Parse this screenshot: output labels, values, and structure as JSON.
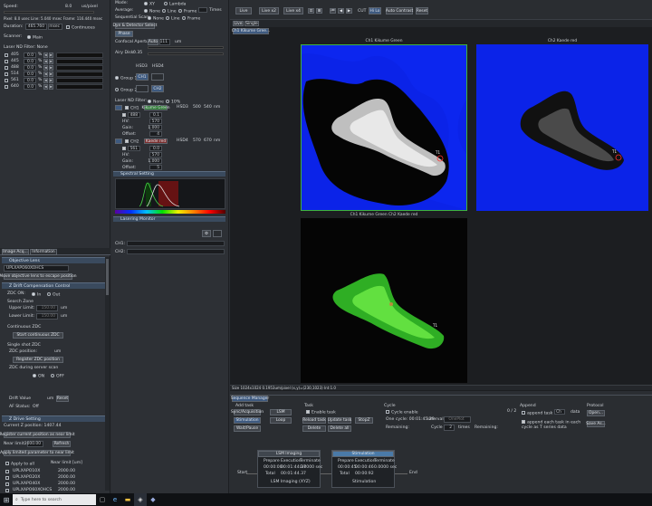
{
  "left": {
    "speed_label": "Speed:",
    "speed_value": "8.0",
    "speed_unit": "us/pixel",
    "pixel_line_frame": "Pixel: 8.0 usec  Line: 5.040 msec  Frame: 116.440 msec",
    "duration_label": "Duration:",
    "duration_value": "465.760",
    "duration_unit": "msec",
    "continuous_label": "Continuous",
    "scanner_label": "Scanner:",
    "scanner_value": "Main",
    "laser_header": "Laser ND Filter: None",
    "lasers": [
      {
        "wl": "405",
        "val": "0.0",
        "unit": "%"
      },
      {
        "wl": "445",
        "val": "0.0",
        "unit": "%"
      },
      {
        "wl": "488",
        "val": "0.0",
        "unit": "%"
      },
      {
        "wl": "514",
        "val": "0.0",
        "unit": "%"
      },
      {
        "wl": "561",
        "val": "0.0",
        "unit": "%"
      },
      {
        "wl": "640",
        "val": "0.0",
        "unit": "%"
      }
    ],
    "tabs": [
      "Image Acq...",
      "Information"
    ],
    "objective_header": "Objective Lens",
    "objective_value": "UPLXAPO60XOHCS",
    "move_objective_btn": "Move objective lens to escape position",
    "zdc_header": "Z Drift Compensation Control",
    "zdc_label": "ZDC ON:",
    "zdc_in": "In",
    "zdc_out": "Out",
    "search_zone": "Search Zone",
    "upper_label": "Upper Limit:",
    "upper_value": "150.00",
    "lower_label": "Lower Limit:",
    "lower_value": "150.00",
    "um": "um",
    "continuous_zdc": "Continuous ZDC",
    "start_zdc_btn": "Start continuous ZDC",
    "single_zdc": "Single shot ZDC",
    "zdc_position": "ZDC position:",
    "zdc_pos_unit": "um",
    "register_btn": "Register ZDC position",
    "zdc_sensor": "ZDC during server scan",
    "on": "ON",
    "off": "OFF",
    "drift_label": "Drift Value",
    "drift_unit": "um",
    "reset_btn": "Reset",
    "af_status": "AF Status:",
    "af_value": "Off",
    "z_header": "Z Drive Setting",
    "current_z": "Current Z position: 1407.44",
    "register_current_btn": "Register current position as near limit",
    "near_label": "Near limit:",
    "near_value": "2000.00",
    "refresh_btn": "Refresh",
    "apply_btn": "Apply limited parameter to near limit",
    "apply_all": "Apply to all",
    "near_limit_col": "Near limit [um]",
    "obj_rows": [
      {
        "name": "UPLXAPO10X",
        "val": "2000.00"
      },
      {
        "name": "UPLXAPO20X",
        "val": "2000.00"
      },
      {
        "name": "UPLXAPO40X",
        "val": "2000.00"
      },
      {
        "name": "UPLXAPO60XOHCS",
        "val": "2000.00"
      }
    ]
  },
  "middle": {
    "mode_label": "Mode:",
    "mode_xy": "XY",
    "mode_lambda": "Lambda",
    "average_label": "Average:",
    "none": "None",
    "line": "Line",
    "frame": "Frame",
    "times": "Times",
    "seq_scan": "Sequential Scan:",
    "none2": "None",
    "line2": "Line",
    "frame2": "Frame",
    "dye_btn": "Dye & Detector Select",
    "phase_btn": "Phase",
    "confocal_label": "Confocal Aperture:",
    "auto_btn": "Auto",
    "pinhole_value": "111",
    "pinhole_unit": "um",
    "airy_label": "Airy Disk:",
    "airy_value": "0.35",
    "hsd3": "HSD3",
    "hsd4": "HSD4",
    "group1": "Group 1",
    "group2": "Group 2",
    "ch1": "CH1",
    "ch2": "CH2",
    "laser_nd": "Laser ND Filter:",
    "laser_nd_none": "None",
    "laser_nd_10": "10%",
    "ch1_row": {
      "name": "CH1",
      "dye": "Kikume Green",
      "det": "HSD3",
      "range1": "500",
      "range2": "540",
      "unit": "nm"
    },
    "ch1_laser": {
      "wl": "488",
      "val": "0.1"
    },
    "hv_label": "HV:",
    "hv1": "570",
    "gain_label": "Gain:",
    "gain1": "1.000",
    "offset_label": "Offset:",
    "off1": "4",
    "ch2_row": {
      "name": "CH2",
      "dye": "Kaede red",
      "det": "HSD4",
      "range1": "570",
      "range2": "670",
      "unit": "nm"
    },
    "ch2_laser": {
      "wl": "561",
      "val": "0.0"
    },
    "hv2": "570",
    "gain2": "1.000",
    "off2": "5",
    "spectral_header": "Spectral Setting",
    "live_hdr": "Lasering Monitor",
    "ch1_lbl": "CH1:",
    "ch2_lbl": "CH2:"
  },
  "toolbar": {
    "btn1": "Live",
    "btn2": "Live x2",
    "btn3": "Live x4",
    "cut": "CUT",
    "hilo": "Hi Lo",
    "auto_contrast": "Auto Contrast",
    "reset": "Reset"
  },
  "viewer_tabs": [
    "Live",
    "Single"
  ],
  "view_tab": "Ch1 Kikume Gree...",
  "images": {
    "ch1_title": "Ch1 Kikume Green",
    "ch2_title": "Ch2 Kaede red",
    "merge_title": "Ch1 Kikume Green Ch2 Kaede red",
    "roi": "T1"
  },
  "status_text": "Size 1024x1024  0.1953um/pixel  (x,y)=(230,1023)  Int:1.0",
  "sequence": {
    "header": "Sequence Manager",
    "task_label": "Add task",
    "task_btns": [
      "Sync/Acquisition",
      "LSM",
      "Stimulation",
      "Loop",
      "Wait/Pause"
    ],
    "task_group": "Task",
    "enable_task": "Enable task",
    "reload_btn": "Reload task",
    "update_btn": "Update task",
    "stopz_btn": "StopZ",
    "delete_btn": "Delete",
    "delete_all_btn": "Delete all",
    "cycle_group": "Cycle",
    "cycle_enable": "Cycle enable",
    "cycle_count": "0 / 2",
    "one_cycle": "One cycle: 00:01:45.29",
    "interval": "Interval",
    "interval_val": "OnePlot",
    "remaining": "Remaining:",
    "cycle_label": "Cycle",
    "times": "times",
    "cycle_val": "2",
    "remaining2": "Remaining:",
    "append_group": "Append",
    "append_task": "append task as",
    "ch_val": "Ch",
    "data": "data",
    "append_each": "append each task in each cycle as T series data",
    "protocol_group": "Protocol",
    "open_btn": "Open...",
    "save_btn": "Save As...",
    "block1": {
      "title": "LSM Imaging",
      "prepare": "Prepare",
      "execution": "Execution",
      "terminate": "Terminate",
      "p": "00:00:00",
      "e": "00:01:44.37",
      "tm": "0.0000 sec",
      "total_lbl": "Total",
      "total": "00:01:44.37",
      "name": "LSM Imaging (XYZ)"
    },
    "block2": {
      "title": "Stimulation",
      "prepare": "Prepare",
      "execution": "Execution",
      "terminate": "Terminate",
      "p": "00:00:45",
      "e": "00:00:46",
      "tm": "0.0000 sec",
      "total_lbl": "Total",
      "total": "00:00:92",
      "name": "Stimulation"
    },
    "start": "Start",
    "end": "End"
  },
  "taskbar": {
    "search_placeholder": "Type here to search"
  }
}
